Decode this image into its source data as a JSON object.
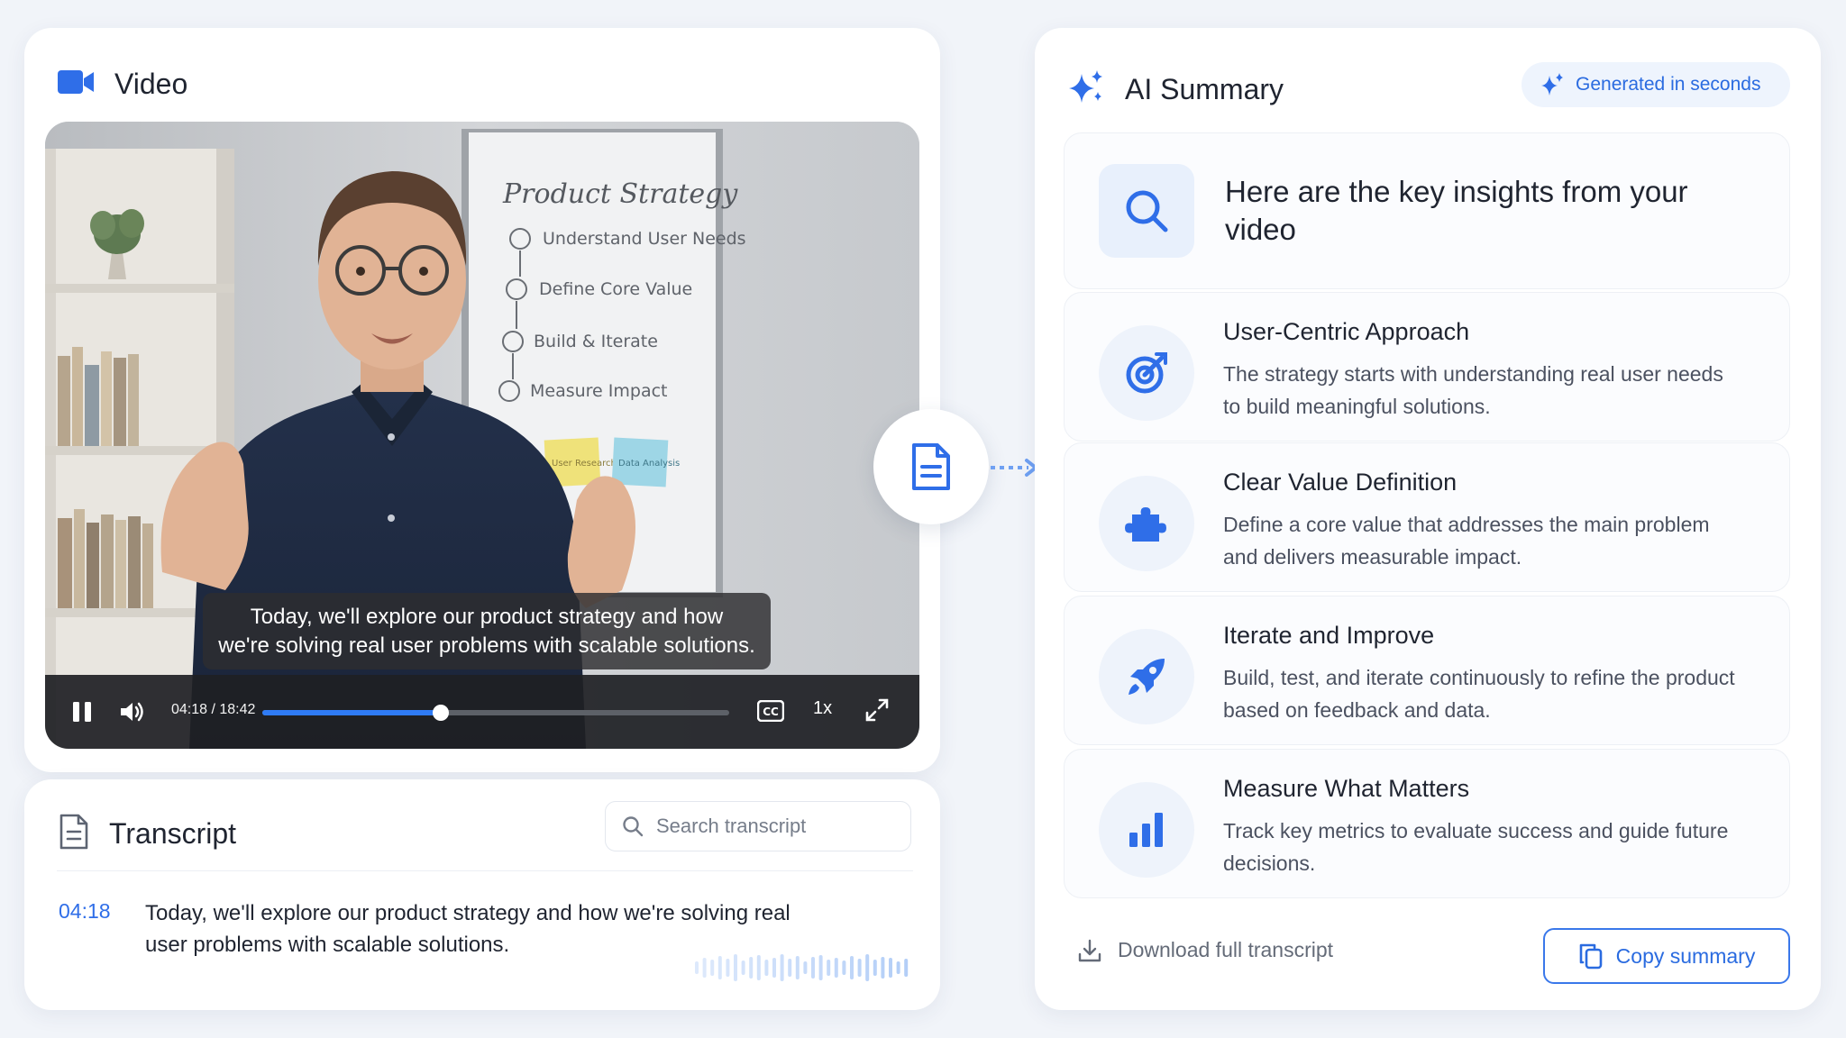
{
  "colors": {
    "accent": "#2f6ee8",
    "text": "#1f2430",
    "muted": "#4b5160",
    "background": "#f1f4f9"
  },
  "video": {
    "title": "Video",
    "icon": "video-camera-icon",
    "whiteboard": {
      "heading": "Product Strategy",
      "steps": [
        "Understand User Needs",
        "Define Core Value",
        "Build & Iterate",
        "Measure Impact"
      ],
      "sticky_notes": [
        "User Research",
        "Data Analysis"
      ]
    },
    "caption": {
      "line1": "Today, we'll explore our product strategy and how",
      "line2": "we're solving real user problems with scalable solutions."
    },
    "controls": {
      "current_time": "04:18",
      "duration": "18:42",
      "time_display": "04:18 / 18:42",
      "progress": 0.383,
      "cc_label": "CC",
      "speed": "1x"
    }
  },
  "transcript": {
    "title": "Transcript",
    "icon": "document-icon",
    "search_placeholder": "Search transcript",
    "entries": [
      {
        "time": "04:18",
        "text": "Today, we'll explore our product strategy and how we're solving real user problems with scalable solutions."
      }
    ]
  },
  "summary": {
    "title": "AI Summary",
    "icon": "sparkle-icon",
    "badge": "Generated in seconds",
    "heading": "Here are the key insights from your video",
    "insights": [
      {
        "title": "User-Centric Approach",
        "description": "The strategy starts with understanding real user needs to build meaningful solutions.",
        "icon": "target-icon"
      },
      {
        "title": "Clear Value Definition",
        "description": "Define a core value that addresses the main problem and delivers measurable impact.",
        "icon": "puzzle-icon"
      },
      {
        "title": "Iterate and Improve",
        "description": "Build, test, and iterate continuously to refine the product based on feedback and data.",
        "icon": "rocket-icon"
      },
      {
        "title": "Measure What Matters",
        "description": "Track key metrics to evaluate success and guide future decisions.",
        "icon": "bar-chart-icon"
      }
    ],
    "download_label": "Download full transcript",
    "copy_label": "Copy summary"
  }
}
